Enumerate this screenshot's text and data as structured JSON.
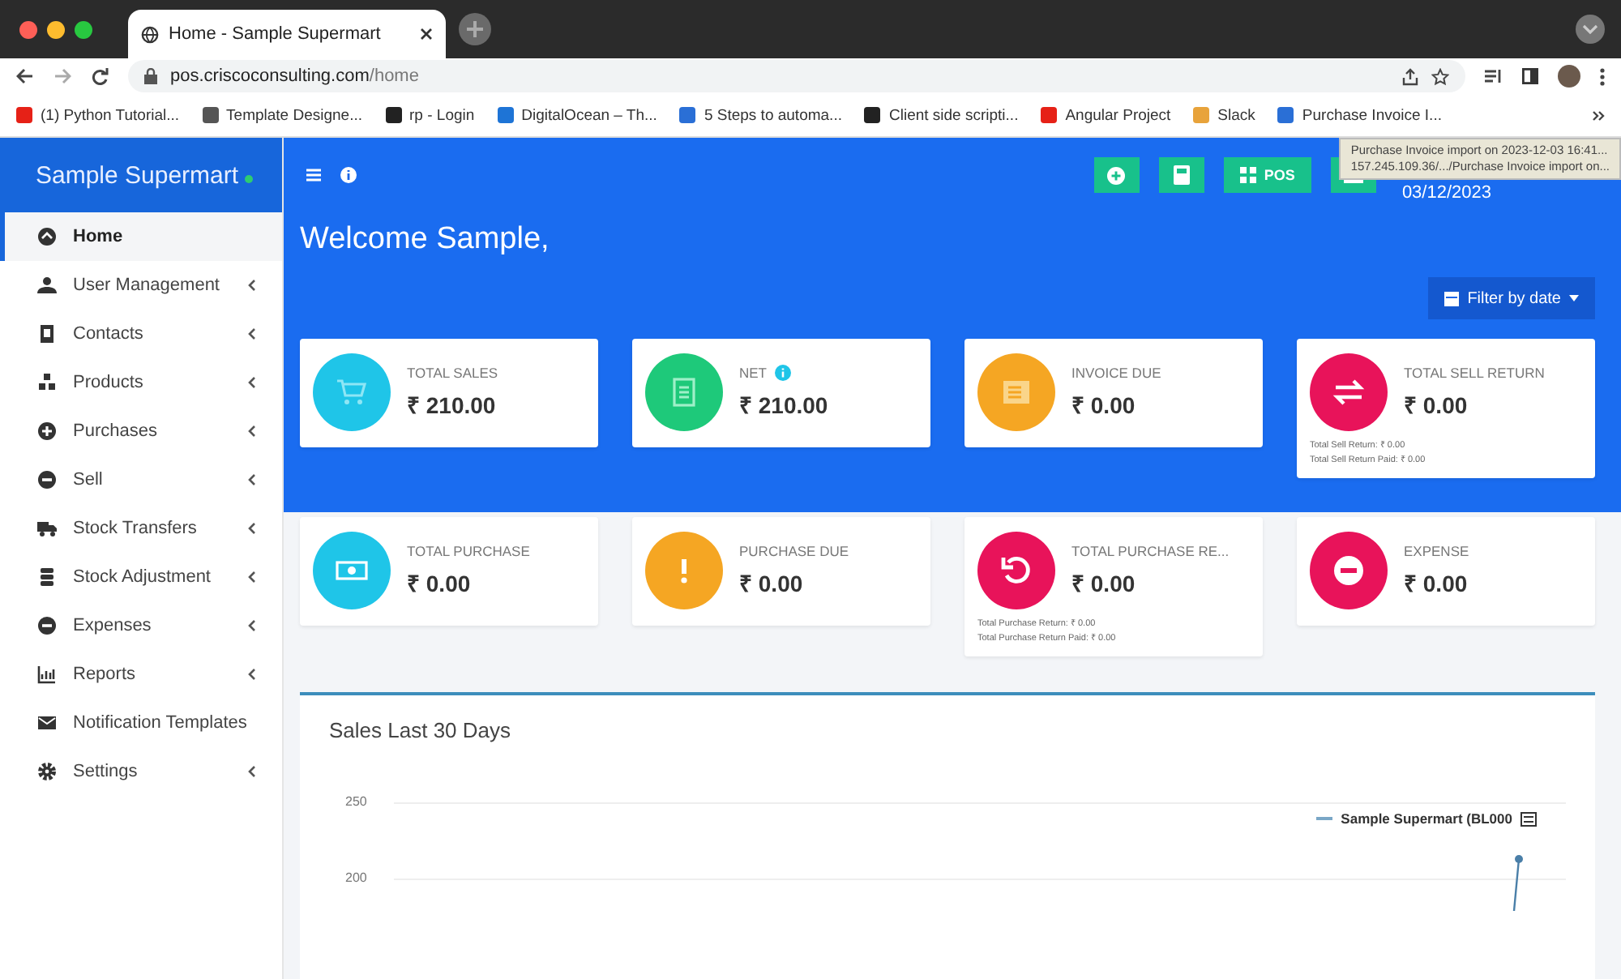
{
  "browser": {
    "tab_title": "Home - Sample Supermart",
    "url_host": "pos.criscoconsulting.com",
    "url_path": "/home",
    "bookmarks": [
      {
        "label": "(1) Python Tutorial...",
        "color": "#e62117"
      },
      {
        "label": "Template Designe...",
        "color": "#555555"
      },
      {
        "label": "rp - Login",
        "color": "#222222"
      },
      {
        "label": "DigitalOcean – Th...",
        "color": "#1e74d6"
      },
      {
        "label": "5 Steps to automa...",
        "color": "#2a6fd6"
      },
      {
        "label": "Client side scripti...",
        "color": "#222222"
      },
      {
        "label": "Angular Project",
        "color": "#e62117"
      },
      {
        "label": "Slack",
        "color": "#e8a33b"
      },
      {
        "label": "Purchase Invoice I...",
        "color": "#2a6fd6"
      }
    ]
  },
  "app": {
    "brand": "Sample Supermart",
    "date": "03/12/2023",
    "pos_label": "POS",
    "tooltip": [
      "Purchase Invoice import on 2023-12-03 16:41...",
      "157.245.109.36/.../Purchase Invoice import on..."
    ]
  },
  "sidebar": {
    "items": [
      {
        "label": "Home",
        "kind": "home",
        "selected": true,
        "expandable": false
      },
      {
        "label": "User Management",
        "kind": "users",
        "selected": false,
        "expandable": true
      },
      {
        "label": "Contacts",
        "kind": "book",
        "selected": false,
        "expandable": true
      },
      {
        "label": "Products",
        "kind": "cubes",
        "selected": false,
        "expandable": true
      },
      {
        "label": "Purchases",
        "kind": "plus",
        "selected": false,
        "expandable": true
      },
      {
        "label": "Sell",
        "kind": "minus",
        "selected": false,
        "expandable": true
      },
      {
        "label": "Stock Transfers",
        "kind": "truck",
        "selected": false,
        "expandable": true
      },
      {
        "label": "Stock Adjustment",
        "kind": "stack",
        "selected": false,
        "expandable": true
      },
      {
        "label": "Expenses",
        "kind": "minus",
        "selected": false,
        "expandable": true
      },
      {
        "label": "Reports",
        "kind": "chart",
        "selected": false,
        "expandable": true
      },
      {
        "label": "Notification Templates",
        "kind": "mail",
        "selected": false,
        "expandable": false
      },
      {
        "label": "Settings",
        "kind": "gear",
        "selected": false,
        "expandable": true
      }
    ]
  },
  "welcome": "Welcome Sample,",
  "filter_button": "Filter by date",
  "cards": [
    {
      "label": "TOTAL SALES",
      "value": "₹ 210.00",
      "kind": "cart",
      "color": "#1fc5e8",
      "info": false
    },
    {
      "label": "NET",
      "value": "₹ 210.00",
      "kind": "receipt",
      "color": "#1ec97a",
      "info": true
    },
    {
      "label": "INVOICE DUE",
      "value": "₹ 0.00",
      "kind": "invoice",
      "color": "#f5a623",
      "info": false
    },
    {
      "label": "TOTAL SELL RETURN",
      "value": "₹ 0.00",
      "kind": "swap",
      "color": "#e8135a",
      "info": false,
      "notes": [
        "Total Sell Return: ₹ 0.00",
        "Total Sell Return Paid: ₹ 0.00"
      ]
    },
    {
      "label": "TOTAL PURCHASE",
      "value": "₹ 0.00",
      "kind": "money",
      "color": "#1fc5e8",
      "info": false
    },
    {
      "label": "PURCHASE DUE",
      "value": "₹ 0.00",
      "kind": "exclaim",
      "color": "#f5a623",
      "info": false
    },
    {
      "label": "TOTAL PURCHASE RE...",
      "value": "₹ 0.00",
      "kind": "undo",
      "color": "#e8135a",
      "info": false,
      "notes": [
        "Total Purchase Return: ₹ 0.00",
        "Total Purchase Return Paid: ₹ 0.00"
      ]
    },
    {
      "label": "EXPENSE",
      "value": "₹ 0.00",
      "kind": "minus",
      "color": "#e8135a",
      "info": false
    }
  ],
  "sales_chart": {
    "title": "Sales Last 30 Days",
    "yticks": [
      "250",
      "200"
    ],
    "legend": "Sample Supermart (BL000"
  }
}
